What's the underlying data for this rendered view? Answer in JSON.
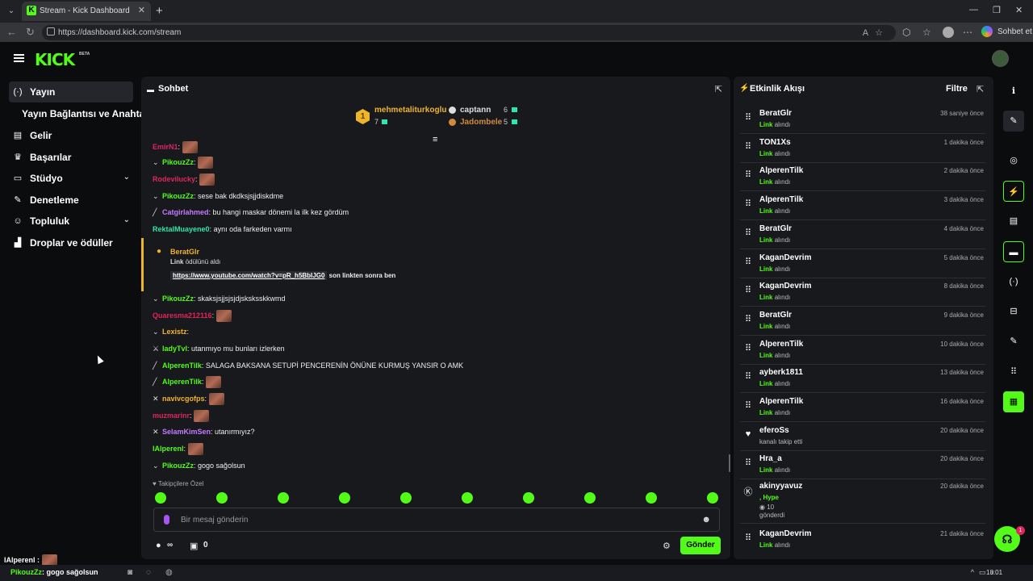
{
  "browser": {
    "tab_title": "Stream - Kick Dashboard",
    "url": "https://dashboard.kick.com/stream",
    "copilot_label": "Sohbet et"
  },
  "header": {
    "logo": "KICK",
    "logo_badge": "BETA"
  },
  "sidebar": {
    "items": [
      {
        "label": "Yayın",
        "icon": "broadcast-icon"
      },
      {
        "label": "Yayın Bağlantısı ve Anahtarı",
        "icon": ""
      },
      {
        "label": "Gelir",
        "icon": "revenue-icon"
      },
      {
        "label": "Başarılar",
        "icon": "trophy-icon"
      },
      {
        "label": "Stüdyo",
        "icon": "studio-icon"
      },
      {
        "label": "Denetleme",
        "icon": "wrench-icon"
      },
      {
        "label": "Topluluk",
        "icon": "community-icon"
      },
      {
        "label": "Droplar ve ödüller",
        "icon": "drops-icon"
      }
    ]
  },
  "chat": {
    "title": "Sohbet",
    "leaderboard": {
      "first": {
        "rank": "1",
        "name": "mehmetaliturkoglu",
        "value": "7"
      },
      "second": {
        "name": "captann",
        "value": "6"
      },
      "third": {
        "name": "Jadombele",
        "value": "5"
      }
    },
    "messages": [
      {
        "user": "EmirN1",
        "color": "#e0245e",
        "text": "",
        "emote": true
      },
      {
        "user": "PikouzZz",
        "color": "#53fc18",
        "text": "",
        "emote": true
      },
      {
        "user": "Rodevilucky",
        "color": "#e0245e",
        "text": "",
        "emote": true
      },
      {
        "user": "PikouzZz",
        "color": "#53fc18",
        "text": "sese bak dkdksjsjjdiskdme",
        "emote": false
      },
      {
        "user": "Catgirlahmed",
        "color": "#c47bff",
        "text": "bu hangi maskar dönemi la ilk kez gördüm",
        "emote": false
      },
      {
        "user": "RektalMuayene0",
        "color": "#2ee6a6",
        "text": "aynı oda farkeden varmı",
        "emote": false
      }
    ],
    "highlight": {
      "user": "BeratGlr",
      "reward_name": "Link",
      "reward_text": "ödülünü aldı",
      "link": "https://www.youtube.com/watch?v=pR_h5BbIJG0",
      "link_suffix": "son linkten sonra ben"
    },
    "messages2": [
      {
        "user": "PikouzZz",
        "color": "#53fc18",
        "text": "skaksjsjjsjsjdjsksksskkwmd",
        "emote": false
      },
      {
        "user": "Quaresma212116",
        "color": "#e0245e",
        "text": "",
        "emote": true
      },
      {
        "user": "Lexistz",
        "color": "#f0b429",
        "text": "",
        "emote": false
      },
      {
        "user": "ladyTvl",
        "color": "#53fc18",
        "text": "utanmıyo mu bunları izlerken",
        "emote": false
      },
      {
        "user": "AlperenTilk",
        "color": "#53fc18",
        "text": "SALAGA BAKSANA SETUPİ PENCERENİN ÖNÜNE KURMUŞ YANSIR O AMK",
        "emote": false
      },
      {
        "user": "AlperenTilk",
        "color": "#53fc18",
        "text": "",
        "emote": true
      },
      {
        "user": "navivcgofps",
        "color": "#f0b429",
        "text": "",
        "emote": true
      },
      {
        "user": "muzmarinr",
        "color": "#e0245e",
        "text": "",
        "emote": true
      },
      {
        "user": "SelamKimSen",
        "color": "#c47bff",
        "text": "utanırmıyız?",
        "emote": false
      },
      {
        "user": "lAlperenl",
        "color": "#53fc18",
        "text": "",
        "emote": true
      },
      {
        "user": "PikouzZz",
        "color": "#53fc18",
        "text": "gogo sağolsun",
        "emote": false
      }
    ],
    "followers_only": "Takipçilere Özel",
    "input_placeholder": "Bir mesaj gönderin",
    "footer": {
      "infinity": "∞",
      "count": "0",
      "send": "Gönder"
    }
  },
  "activity": {
    "title": "Etkinlik Akışı",
    "filter": "Filtre",
    "items": [
      {
        "user": "BeratGlr",
        "desc_bold": "Link",
        "desc": "alındı",
        "time": "38 saniye önce",
        "icon": "redeem-icon"
      },
      {
        "user": "TON1Xs",
        "desc_bold": "Link",
        "desc": "alındı",
        "time": "1 dakika önce",
        "icon": "redeem-icon"
      },
      {
        "user": "AlperenTilk",
        "desc_bold": "Link",
        "desc": "alındı",
        "time": "2 dakika önce",
        "icon": "redeem-icon"
      },
      {
        "user": "AlperenTilk",
        "desc_bold": "Link",
        "desc": "alındı",
        "time": "3 dakika önce",
        "icon": "redeem-icon"
      },
      {
        "user": "BeratGlr",
        "desc_bold": "Link",
        "desc": "alındı",
        "time": "4 dakika önce",
        "icon": "redeem-icon"
      },
      {
        "user": "KaganDevrim",
        "desc_bold": "Link",
        "desc": "alındı",
        "time": "5 dakika önce",
        "icon": "redeem-icon"
      },
      {
        "user": "KaganDevrim",
        "desc_bold": "Link",
        "desc": "alındı",
        "time": "8 dakika önce",
        "icon": "redeem-icon"
      },
      {
        "user": "BeratGlr",
        "desc_bold": "Link",
        "desc": "alındı",
        "time": "9 dakika önce",
        "icon": "redeem-icon"
      },
      {
        "user": "AlperenTilk",
        "desc_bold": "Link",
        "desc": "alındı",
        "time": "10 dakika önce",
        "icon": "redeem-icon"
      },
      {
        "user": "ayberk1811",
        "desc_bold": "Link",
        "desc": "alındı",
        "time": "13 dakika önce",
        "icon": "redeem-icon"
      },
      {
        "user": "AlperenTilk",
        "desc_bold": "Link",
        "desc": "alındı",
        "time": "16 dakika önce",
        "icon": "redeem-icon"
      },
      {
        "user": "eferoSs",
        "desc_bold": "",
        "desc": "kanalı takip etti",
        "time": "20 dakika önce",
        "icon": "heart-icon"
      },
      {
        "user": "Hra_a",
        "desc_bold": "Link",
        "desc": "alındı",
        "time": "20 dakika önce",
        "icon": "redeem-icon"
      }
    ],
    "hype_item": {
      "user": "akinyyavuz",
      "hype": ", Hype",
      "amount": "10",
      "sent": "gönderdi",
      "time": "20 dakika önce"
    },
    "last_item": {
      "user": "KaganDevrim",
      "desc_bold": "Link",
      "desc": "alındı",
      "time": "21 dakika önce"
    }
  },
  "help_badge": "1",
  "overlay": {
    "user": "lAlperenl :"
  },
  "taskbar": {
    "user": "PikouzZz",
    "text": ": gogo sağolsun",
    "clock": "18:01"
  },
  "colors": {
    "accent": "#53fc18",
    "gold": "#f0b429",
    "panel": "#18191d",
    "bg": "#0b0c0e"
  }
}
